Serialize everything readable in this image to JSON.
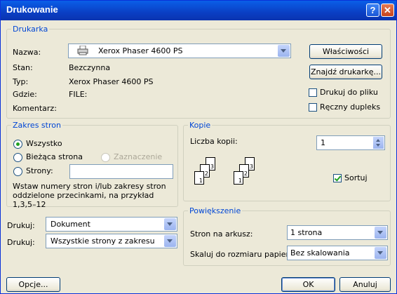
{
  "window": {
    "title": "Drukowanie",
    "help_glyph": "?",
    "close_glyph": "✕"
  },
  "printer": {
    "group_label": "Drukarka",
    "name_label": "Nazwa:",
    "name_value": "Xerox Phaser 4600 PS",
    "properties_button": "Właściwości",
    "find_button": "Znajdź drukarkę...",
    "status_label": "Stan:",
    "status_value": "Bezczynna",
    "type_label": "Typ:",
    "type_value": "Xerox Phaser 4600 PS",
    "where_label": "Gdzie:",
    "where_value": "FILE:",
    "comment_label": "Komentarz:",
    "print_to_file": "Drukuj do pliku",
    "manual_duplex": "Ręczny dupleks"
  },
  "range": {
    "group_label": "Zakres stron",
    "all": "Wszystko",
    "current": "Bieżąca strona",
    "selection": "Zaznaczenie",
    "pages": "Strony:",
    "pages_value": "",
    "hint": "Wstaw numery stron i/lub zakresy stron oddzielone przecinkami, na przykład 1,3,5–12"
  },
  "copies": {
    "group_label": "Kopie",
    "count_label": "Liczba kopii:",
    "count_value": "1",
    "collate": "Sortuj",
    "collate_checked": true,
    "page_numbers": [
      "1",
      "2",
      "3"
    ]
  },
  "print_what": {
    "label": "Drukuj:",
    "value": "Dokument"
  },
  "print_pages": {
    "label": "Drukuj:",
    "value": "Wszystkie strony z zakresu"
  },
  "zoom": {
    "group_label": "Powiększenie",
    "per_sheet_label": "Stron na arkusz:",
    "per_sheet_value": "1 strona",
    "scale_label": "Skaluj do rozmiaru papieru:",
    "scale_value": "Bez skalowania"
  },
  "buttons": {
    "options": "Opcje...",
    "ok": "OK",
    "cancel": "Anuluj"
  }
}
